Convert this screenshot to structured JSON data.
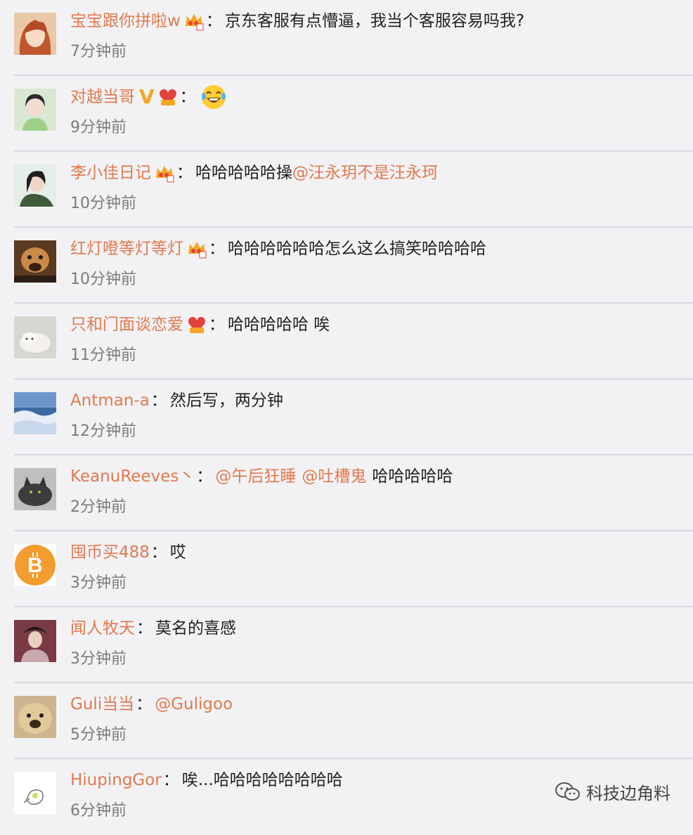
{
  "comments": [
    {
      "username": "宝宝跟你拼啦w",
      "badge": "crown",
      "text": "京东客服有点懵逼，我当个客服容易吗我?",
      "mention_a": "",
      "mention_b": "",
      "time": "7分钟前"
    },
    {
      "username": "对越当哥",
      "badge": "vip-heart",
      "text": "",
      "mention_a": "",
      "mention_b": "",
      "time": "9分钟前",
      "emoji": "laughing-tears-emoji",
      "verified": "V"
    },
    {
      "username": "李小佳日记",
      "badge": "crown",
      "text": "哈哈哈哈哈操",
      "mention_a": "@汪永玥不是汪永珂",
      "mention_b": "",
      "time": "10分钟前"
    },
    {
      "username": "红灯噔等灯等灯",
      "badge": "crown",
      "text": "哈哈哈哈哈哈怎么这么搞笑哈哈哈哈",
      "mention_a": "",
      "mention_b": "",
      "time": "10分钟前"
    },
    {
      "username": "只和门面谈恋爱",
      "badge": "vip-heart",
      "text": "哈哈哈哈哈 唉",
      "mention_a": "",
      "mention_b": "",
      "time": "11分钟前"
    },
    {
      "username": "Antman-a",
      "badge": "",
      "text": "然后写，两分钟",
      "mention_a": "",
      "mention_b": "",
      "time": "12分钟前"
    },
    {
      "username": "KeanuReeves丶",
      "badge": "",
      "text": "哈哈哈哈哈",
      "mention_a": "@午后狂睡",
      "mention_b": "@吐槽鬼",
      "time": "2分钟前"
    },
    {
      "username": "囤币买488",
      "badge": "",
      "text": "哎",
      "mention_a": "",
      "mention_b": "",
      "time": "3分钟前"
    },
    {
      "username": "闻人牧天",
      "badge": "",
      "text": "莫名的喜感",
      "mention_a": "",
      "mention_b": "",
      "time": "3分钟前"
    },
    {
      "username": "Guli当当",
      "badge": "",
      "text": "",
      "mention_a": "@Guligoo",
      "mention_b": "",
      "time": "5分钟前"
    },
    {
      "username": "HiupingGor",
      "badge": "",
      "text": "唉...哈哈哈哈哈哈哈哈",
      "mention_a": "",
      "mention_b": "",
      "time": "6分钟前"
    }
  ],
  "colon": "：",
  "watermark": {
    "label": "科技边角料",
    "icon": "wechat-icon"
  },
  "colors": {
    "username": "#e07a4e",
    "text": "#222222",
    "time": "#7b7b7b",
    "background": "#f2f2f5",
    "divider": "#d9d9de"
  }
}
